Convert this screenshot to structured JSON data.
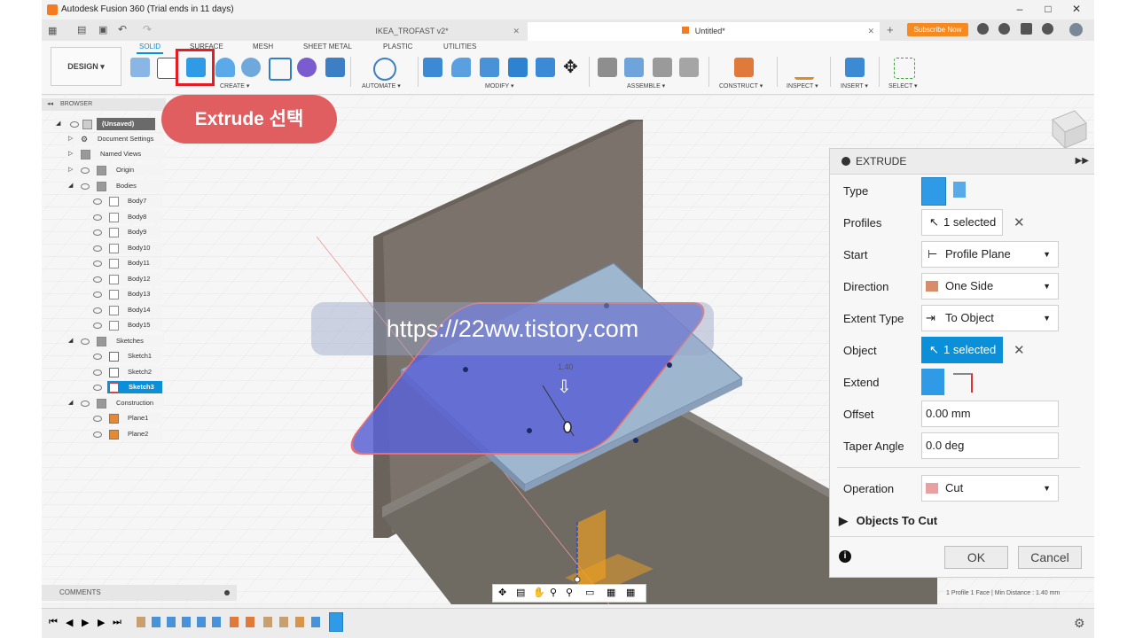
{
  "window": {
    "title": "Autodesk Fusion 360 (Trial ends in 11 days)"
  },
  "tabs": [
    {
      "label": "IKEA_TROFAST v2*"
    },
    {
      "label": "Untitled*"
    }
  ],
  "subscribe_label": "Subscribe Now",
  "toolbar": {
    "design_label": "DESIGN ▾",
    "workspace_tabs": [
      "SOLID",
      "SURFACE",
      "MESH",
      "SHEET METAL",
      "PLASTIC",
      "UTILITIES"
    ],
    "groups": [
      "CREATE ▾",
      "AUTOMATE ▾",
      "MODIFY ▾",
      "ASSEMBLE ▾",
      "CONSTRUCT ▾",
      "INSPECT ▾",
      "INSERT ▾",
      "SELECT ▾"
    ]
  },
  "callout": "Extrude 선택",
  "watermark": "https://22ww.tistory.com",
  "browser": {
    "header": "BROWSER",
    "nodes": [
      "(Unsaved)",
      "Document Settings",
      "Named Views",
      "Origin",
      "Bodies",
      "Body7",
      "Body8",
      "Body9",
      "Body10",
      "Body11",
      "Body12",
      "Body13",
      "Body14",
      "Body15",
      "Sketches",
      "Sketch1",
      "Sketch2",
      "Sketch3",
      "Construction",
      "Plane1",
      "Plane2"
    ]
  },
  "dimension_label": "1.40",
  "extrude": {
    "title": "EXTRUDE",
    "type_label": "Type",
    "profiles_label": "Profiles",
    "profiles_value": "1 selected",
    "start_label": "Start",
    "start_value": "Profile Plane",
    "direction_label": "Direction",
    "direction_value": "One Side",
    "extent_label": "Extent Type",
    "extent_value": "To Object",
    "object_label": "Object",
    "object_value": "1 selected",
    "extend_label": "Extend",
    "offset_label": "Offset",
    "offset_value": "0.00 mm",
    "taper_label": "Taper Angle",
    "taper_value": "0.0 deg",
    "operation_label": "Operation",
    "operation_value": "Cut",
    "objects_to_cut": "Objects To Cut",
    "ok": "OK",
    "cancel": "Cancel"
  },
  "comments_label": "COMMENTS",
  "status": "1 Profile 1 Face | Min Distance : 1.40 mm",
  "colors": {
    "accent": "#0a8fd8",
    "callout": "#e05d60",
    "highlight": "#e51c23",
    "subscribe": "#f48a20"
  }
}
